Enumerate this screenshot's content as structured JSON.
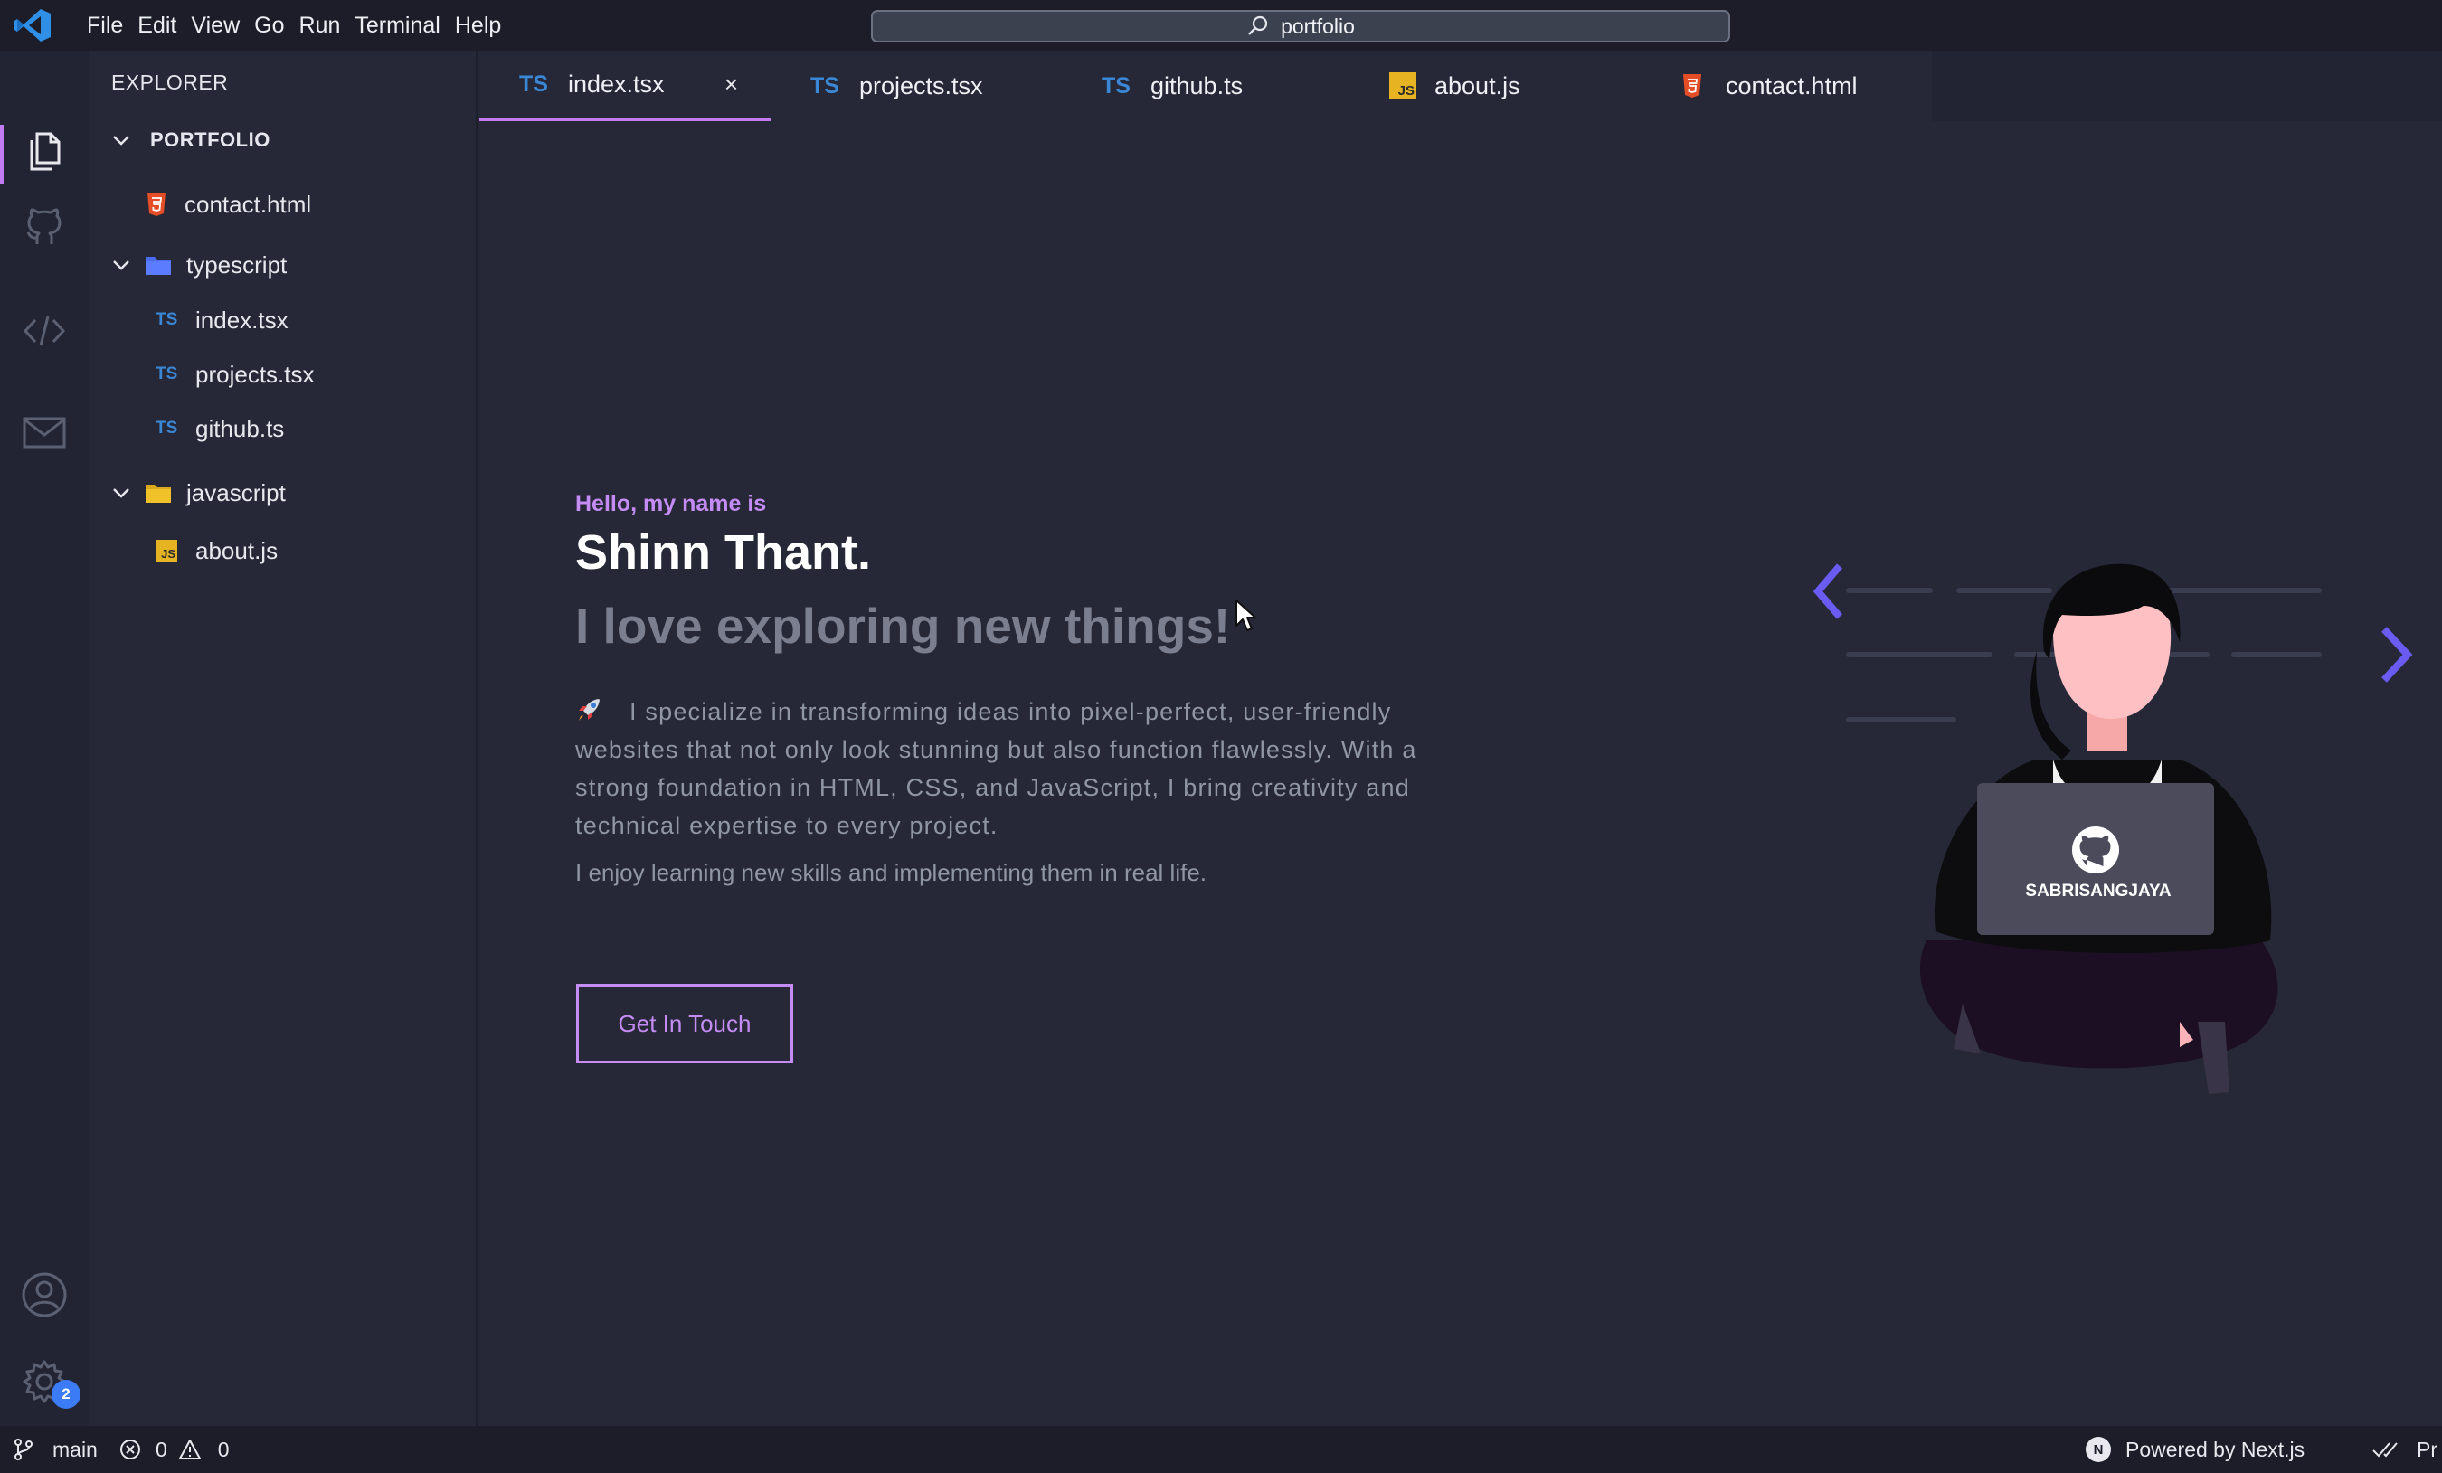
{
  "menu": [
    "File",
    "Edit",
    "View",
    "Go",
    "Run",
    "Terminal",
    "Help"
  ],
  "command_center": {
    "text": "portfolio"
  },
  "activity_bar": {
    "icons": [
      "files-icon",
      "github-icon",
      "code-icon",
      "mail-icon",
      "account-icon",
      "settings-icon"
    ],
    "settings_badge": "2"
  },
  "explorer": {
    "title": "EXPLORER",
    "root": "PORTFOLIO",
    "items": [
      {
        "label": "contact.html",
        "type": "html"
      },
      {
        "label": "typescript",
        "type": "folder"
      },
      {
        "label": "index.tsx",
        "type": "ts"
      },
      {
        "label": "projects.tsx",
        "type": "ts"
      },
      {
        "label": "github.ts",
        "type": "ts"
      },
      {
        "label": "javascript",
        "type": "folder"
      },
      {
        "label": "about.js",
        "type": "js"
      }
    ]
  },
  "tabs": [
    {
      "label": "index.tsx",
      "type": "ts",
      "active": true
    },
    {
      "label": "projects.tsx",
      "type": "ts"
    },
    {
      "label": "github.ts",
      "type": "ts"
    },
    {
      "label": "about.js",
      "type": "js"
    },
    {
      "label": "contact.html",
      "type": "html"
    }
  ],
  "glyphs": {
    "ts": "TS",
    "js": "JS",
    "close": "×"
  },
  "hero": {
    "greeting": "Hello, my name is",
    "name": "Shinn Thant.",
    "tagline": "I love exploring new things!",
    "description": "I specialize in transforming ideas into pixel-perfect, user-friendly websites that not only look stunning but also function flawlessly. With a strong foundation in HTML, CSS, and JavaScript, I bring creativity and technical expertise to every project.",
    "secondary": "I enjoy learning new skills and implementing them in real life.",
    "cta": "Get In Touch"
  },
  "illustration": {
    "laptop_text": "SABRISANGJAYA"
  },
  "statusbar": {
    "branch": "main",
    "errors": "0",
    "warnings": "0",
    "powered_by": "Powered by Next.js",
    "right_truncated": "Pr"
  },
  "colors": {
    "accent": "#c68cf5",
    "ts": "#3a87d6",
    "js": "#e6b422",
    "html": "#e44d26",
    "arrow": "#6a5cf2"
  }
}
